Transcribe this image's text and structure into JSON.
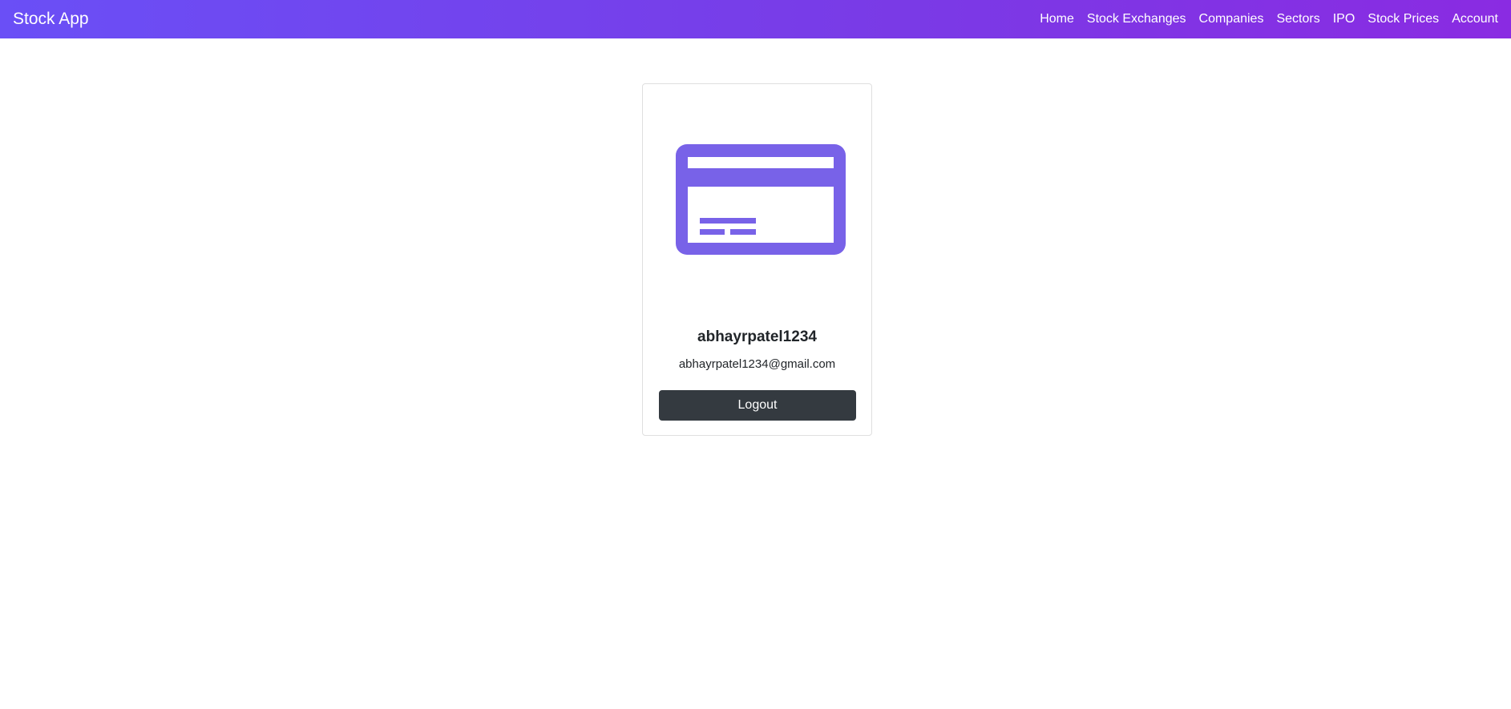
{
  "app": {
    "brand": "Stock App"
  },
  "nav": {
    "items": [
      {
        "label": "Home"
      },
      {
        "label": "Stock Exchanges"
      },
      {
        "label": "Companies"
      },
      {
        "label": "Sectors"
      },
      {
        "label": "IPO"
      },
      {
        "label": "Stock Prices"
      },
      {
        "label": "Account"
      }
    ]
  },
  "account": {
    "icon": "credit-card-icon",
    "username": "abhayrpatel1234",
    "email": "abhayrpatel1234@gmail.com",
    "logout_label": "Logout"
  },
  "colors": {
    "navbar_start": "#6a4ff6",
    "navbar_end": "#8a2be2",
    "icon": "#7862e8",
    "button": "#343a40"
  }
}
